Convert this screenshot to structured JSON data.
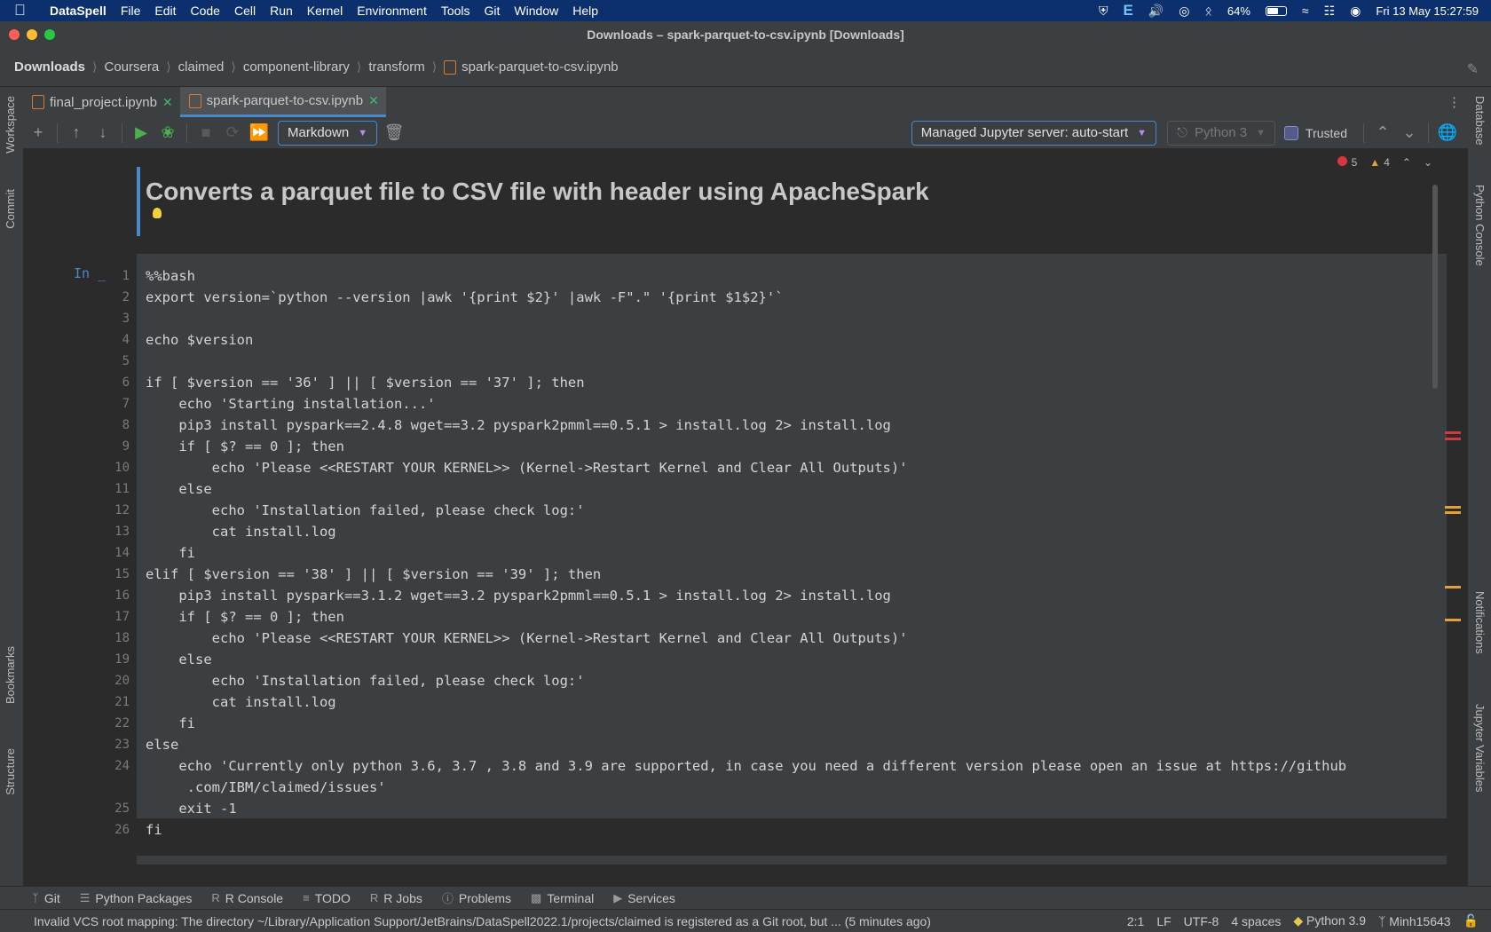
{
  "menubar": {
    "app_name": "DataSpell",
    "items": [
      "File",
      "Edit",
      "Code",
      "Cell",
      "Run",
      "Kernel",
      "Environment",
      "Tools",
      "Git",
      "Window",
      "Help"
    ],
    "battery": "64%",
    "battery_level": 0.64,
    "datetime": "Fri 13 May  15:27:59"
  },
  "window": {
    "title": "Downloads – spark-parquet-to-csv.ipynb [Downloads]"
  },
  "breadcrumbs": [
    "Downloads",
    "Coursera",
    "claimed",
    "component-library",
    "transform",
    "spark-parquet-to-csv.ipynb"
  ],
  "tabs": [
    {
      "label": "final_project.ipynb",
      "active": false
    },
    {
      "label": "spark-parquet-to-csv.ipynb",
      "active": true
    }
  ],
  "toolbar": {
    "cell_type": "Markdown",
    "server": "Managed Jupyter server: auto-start",
    "kernel": "Python 3",
    "trusted_label": "Trusted"
  },
  "inspections": {
    "errors": "5",
    "warnings": "4"
  },
  "left_tools": [
    "Workspace",
    "Commit",
    "Bookmarks",
    "Structure"
  ],
  "right_tools": [
    "Database",
    "Python Console",
    "Notifications",
    "Jupyter Variables"
  ],
  "markdown_cell": {
    "heading": "Converts a parquet file to CSV file with header using ApacheSpark"
  },
  "code_cell": {
    "prompt": "In _",
    "line_numbers": [
      "1",
      "2",
      "3",
      "4",
      "5",
      "6",
      "7",
      "8",
      "9",
      "10",
      "11",
      "12",
      "13",
      "14",
      "15",
      "16",
      "17",
      "18",
      "19",
      "20",
      "21",
      "22",
      "23",
      "24",
      "",
      "25",
      "26"
    ],
    "lines": [
      "%%bash",
      "export version=`python --version |awk '{print $2}' |awk -F\".\" '{print $1$2}'`",
      "",
      "echo $version",
      "",
      "if [ $version == '36' ] || [ $version == '37' ]; then",
      "    echo 'Starting installation...'",
      "    pip3 install pyspark==2.4.8 wget==3.2 pyspark2pmml==0.5.1 > install.log 2> install.log",
      "    if [ $? == 0 ]; then",
      "        echo 'Please <<RESTART YOUR KERNEL>> (Kernel->Restart Kernel and Clear All Outputs)'",
      "    else",
      "        echo 'Installation failed, please check log:'",
      "        cat install.log",
      "    fi",
      "elif [ $version == '38' ] || [ $version == '39' ]; then",
      "    pip3 install pyspark==3.1.2 wget==3.2 pyspark2pmml==0.5.1 > install.log 2> install.log",
      "    if [ $? == 0 ]; then",
      "        echo 'Please <<RESTART YOUR KERNEL>> (Kernel->Restart Kernel and Clear All Outputs)'",
      "    else",
      "        echo 'Installation failed, please check log:'",
      "        cat install.log",
      "    fi",
      "else",
      "    echo 'Currently only python 3.6, 3.7 , 3.8 and 3.9 are supported, in case you need a different version please open an issue at https://github",
      "     .com/IBM/claimed/issues'",
      "    exit -1",
      "fi"
    ]
  },
  "bottom_tools": [
    "Git",
    "Python Packages",
    "R Console",
    "TODO",
    "R Jobs",
    "Problems",
    "Terminal",
    "Services"
  ],
  "status": {
    "message": "Invalid VCS root mapping: The directory ~/Library/Application Support/JetBrains/DataSpell2022.1/projects/claimed is registered as a Git root, but ... (5 minutes ago)",
    "position": "2:1",
    "line_ending": "LF",
    "encoding": "UTF-8",
    "indent": "4 spaces",
    "interpreter": "Python 3.9",
    "branch": "Minh15643"
  },
  "colors": {
    "accent": "#4a88c7",
    "background": "#2b2b2b",
    "panel": "#3c3f41",
    "menubar": "#0c2f6e"
  }
}
